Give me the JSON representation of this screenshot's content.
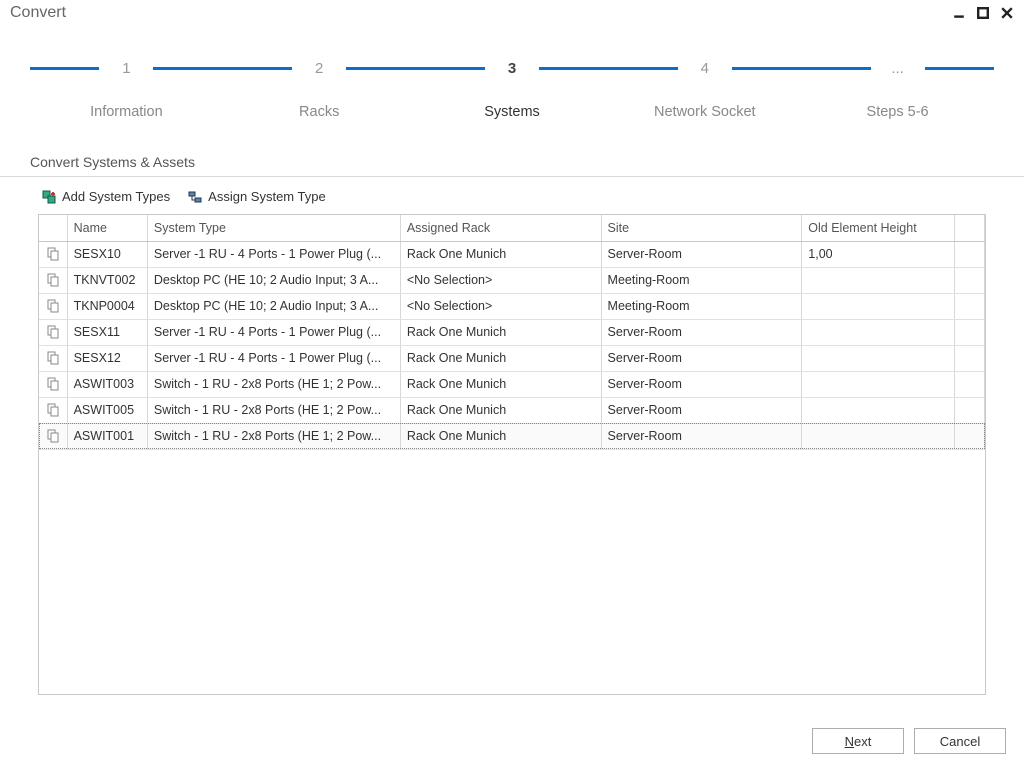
{
  "window": {
    "title": "Convert"
  },
  "steps": [
    {
      "num": "1",
      "label": "Information"
    },
    {
      "num": "2",
      "label": "Racks"
    },
    {
      "num": "3",
      "label": "Systems"
    },
    {
      "num": "4",
      "label": "Network Socket"
    },
    {
      "num": "...",
      "label": "Steps 5-6"
    }
  ],
  "active_step_index": 2,
  "section_title": "Convert Systems & Assets",
  "toolbar": {
    "add_types": "Add System Types",
    "assign_type": "Assign System Type"
  },
  "columns": {
    "name": "Name",
    "system_type": "System Type",
    "assigned_rack": "Assigned Rack",
    "site": "Site",
    "old_height": "Old Element Height"
  },
  "rows": [
    {
      "name": "SESX10",
      "system_type": "Server  -1 RU - 4 Ports - 1 Power Plug (...",
      "assigned_rack": "Rack One Munich",
      "site": "Server-Room",
      "old_height": "1,00"
    },
    {
      "name": "TKNVT002",
      "system_type": "Desktop PC (HE 10; 2 Audio Input; 3 A...",
      "assigned_rack": "<No Selection>",
      "site": "Meeting-Room",
      "old_height": ""
    },
    {
      "name": "TKNP0004",
      "system_type": "Desktop PC (HE 10; 2 Audio Input; 3 A...",
      "assigned_rack": "<No Selection>",
      "site": "Meeting-Room",
      "old_height": ""
    },
    {
      "name": "SESX11",
      "system_type": "Server  -1 RU - 4 Ports - 1 Power Plug (...",
      "assigned_rack": "Rack One Munich",
      "site": "Server-Room",
      "old_height": ""
    },
    {
      "name": "SESX12",
      "system_type": "Server  -1 RU - 4 Ports - 1 Power Plug (...",
      "assigned_rack": "Rack One Munich",
      "site": "Server-Room",
      "old_height": ""
    },
    {
      "name": "ASWIT003",
      "system_type": "Switch - 1 RU -  2x8 Ports (HE 1; 2 Pow...",
      "assigned_rack": "Rack One Munich",
      "site": "Server-Room",
      "old_height": ""
    },
    {
      "name": "ASWIT005",
      "system_type": "Switch - 1 RU -  2x8 Ports (HE 1; 2 Pow...",
      "assigned_rack": "Rack One Munich",
      "site": "Server-Room",
      "old_height": ""
    },
    {
      "name": "ASWIT001",
      "system_type": "Switch - 1 RU -  2x8 Ports (HE 1; 2 Pow...",
      "assigned_rack": "Rack One Munich",
      "site": "Server-Room",
      "old_height": ""
    }
  ],
  "selected_row_index": 7,
  "footer": {
    "next": "Next",
    "cancel": "Cancel"
  }
}
